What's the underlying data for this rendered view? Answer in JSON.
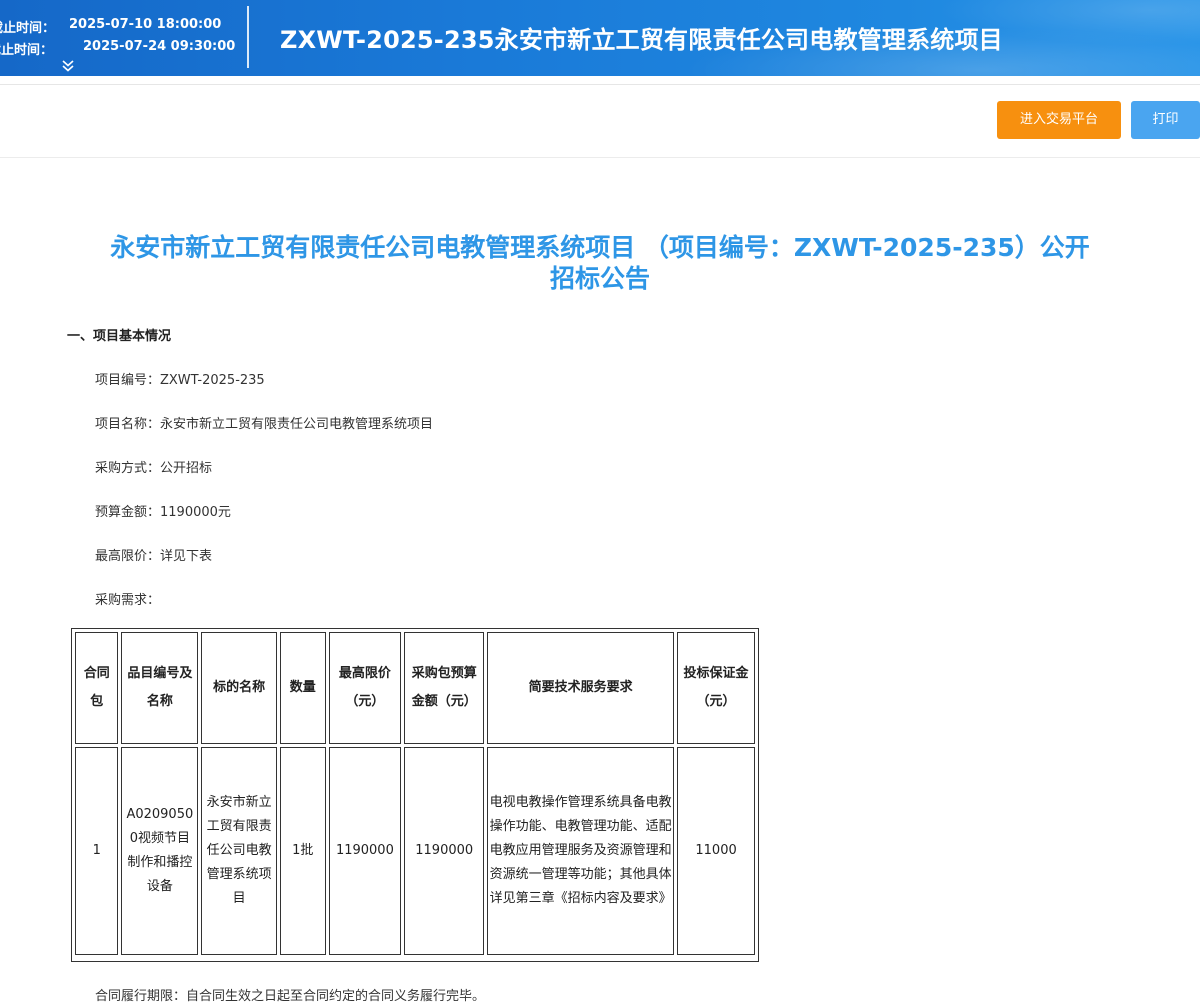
{
  "banner": {
    "deadline_label": "截止时间：",
    "deadline_value": "2025-07-10 18:00:00",
    "open_label": "截止时间：",
    "open_value": "2025-07-24 09:30:00",
    "title": "ZXWT-2025-235永安市新立工贸有限责任公司电教管理系统项目",
    "expand_icon": "double-chevron-down-icon"
  },
  "toolbar": {
    "trade_button": "进入交易平台",
    "print_button": "打印",
    "colors": {
      "trade": "#f7900f",
      "print": "#4aa5f0"
    }
  },
  "document": {
    "title_line1": "永安市新立工贸有限责任公司电教管理系统项目 （项目编号：ZXWT-2025-235）公开",
    "title_line2": "招标公告",
    "section1": "一、项目基本情况",
    "project_no": "项目编号：ZXWT-2025-235",
    "project_name": "项目名称：永安市新立工贸有限责任公司电教管理系统项目",
    "procurement_method": "采购方式：公开招标",
    "budget": "预算金额：1190000元",
    "max_price": "最高限价：详见下表",
    "requirements": "采购需求：",
    "footer_text": "合同履行期限：自合同生效之日起至合同约定的合同义务履行完毕。"
  },
  "table": {
    "headers": [
      "合同包",
      "品目编号及名称",
      "标的名称",
      "数量",
      "最高限价（元）",
      "采购包预算金额（元）",
      "简要技术服务要求",
      "投标保证金（元）"
    ],
    "rows": [
      [
        "1",
        "A02090500视频节目制作和播控设备",
        "永安市新立工贸有限责任公司电教管理系统项目",
        "1批",
        "1190000",
        "1190000",
        "电视电教操作管理系统具备电教操作功能、电教管理功能、适配电教应用管理服务及资源管理和资源统一管理等功能；其他具体详见第三章《招标内容及要求》",
        "11000"
      ]
    ]
  }
}
